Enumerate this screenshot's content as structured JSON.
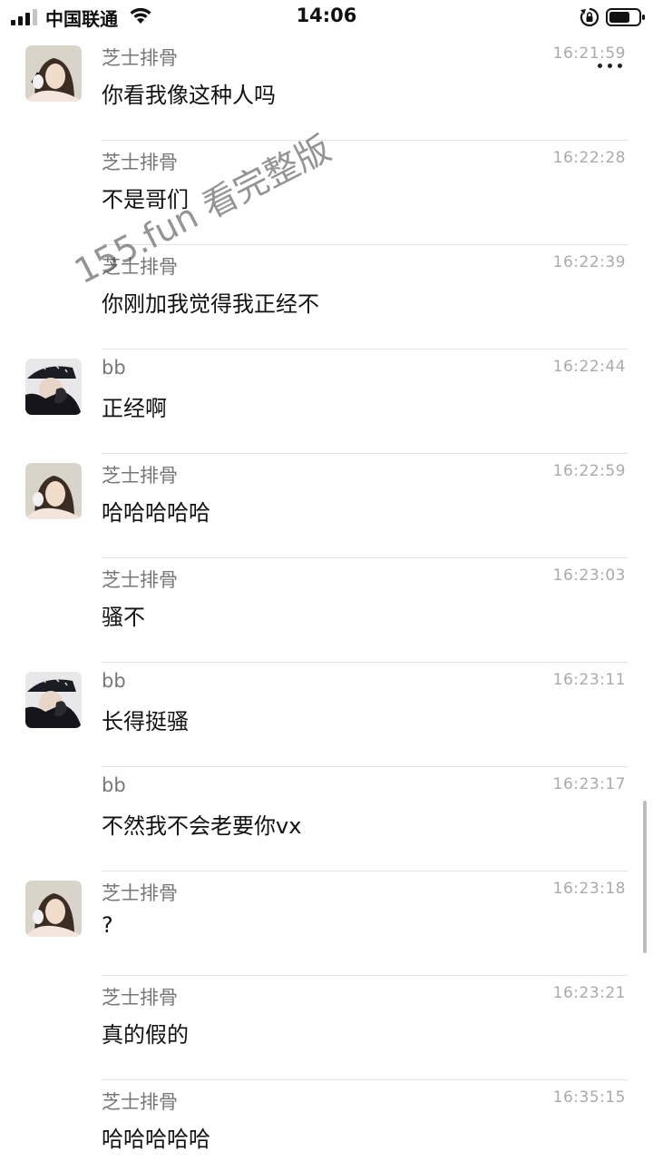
{
  "status_bar": {
    "carrier": "中国联通",
    "time": "14:06",
    "icons": [
      "signal-icon",
      "wifi-icon",
      "rotation-lock-icon",
      "battery-icon"
    ]
  },
  "header": {
    "more_icon": "more-icon"
  },
  "messages": [
    {
      "sender": "芝士排骨",
      "time": "16:21:59",
      "text": "你看我像这种人吗",
      "avatar": "girl"
    },
    {
      "sender": "芝士排骨",
      "time": "16:22:28",
      "text": "不是哥们",
      "avatar": ""
    },
    {
      "sender": "芝士排骨",
      "time": "16:22:39",
      "text": "你刚加我觉得我正经不",
      "avatar": ""
    },
    {
      "sender": "bb",
      "time": "16:22:44",
      "text": "正经啊",
      "avatar": "guy"
    },
    {
      "sender": "芝士排骨",
      "time": "16:22:59",
      "text": "哈哈哈哈哈",
      "avatar": "girl"
    },
    {
      "sender": "芝士排骨",
      "time": "16:23:03",
      "text": "骚不",
      "avatar": ""
    },
    {
      "sender": "bb",
      "time": "16:23:11",
      "text": "长得挺骚",
      "avatar": "guy"
    },
    {
      "sender": "bb",
      "time": "16:23:17",
      "text": "不然我不会老要你vx",
      "avatar": ""
    },
    {
      "sender": "芝士排骨",
      "time": "16:23:18",
      "text": "?",
      "avatar": "girl"
    },
    {
      "sender": "芝士排骨",
      "time": "16:23:21",
      "text": "真的假的",
      "avatar": ""
    },
    {
      "sender": "芝士排骨",
      "time": "16:35:15",
      "text": "哈哈哈哈哈",
      "avatar": ""
    }
  ],
  "watermark": "155.fun 看完整版"
}
